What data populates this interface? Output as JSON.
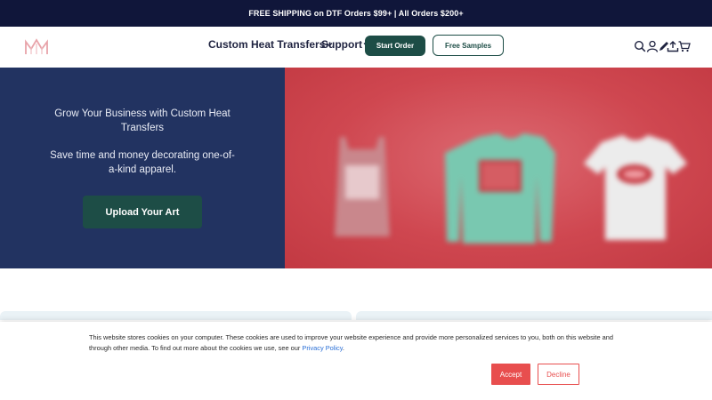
{
  "announcement": {
    "text": "FREE SHIPPING on DTF Orders $99+ | All Orders $200+"
  },
  "header": {
    "logo_icon": "brand-logo-icon",
    "nav": [
      {
        "label": "Custom Heat Transfers",
        "icon": "chevron-down-icon"
      },
      {
        "label": "Support",
        "icon": "chevron-down-icon"
      }
    ],
    "start_order_label": "Start Order",
    "free_samples_label": "Free Samples",
    "icons": [
      "search-icon",
      "account-icon",
      "design-tool-icon",
      "upload-icon",
      "cart-icon"
    ]
  },
  "hero": {
    "heading": "Grow Your Business with Custom Heat Transfers",
    "subheading": "Save time and money decorating one-of-a-kind apparel.",
    "cta_label": "Upload Your Art",
    "image_desc": "apparel-mockups-image"
  },
  "cookie": {
    "text": "This website stores cookies on your computer. These cookies are used to improve your website experience and provide more personalized services to you, both on this website and through other media. To find out more about the cookies we use, see our",
    "link_label": "Privacy Policy",
    "after_link": ".",
    "accept_label": "Accept",
    "decline_label": "Decline"
  },
  "colors": {
    "announce_bg": "#10163a",
    "hero_bg": "#223361",
    "primary": "#1d4d46",
    "accent_red": "#e84e4e"
  }
}
